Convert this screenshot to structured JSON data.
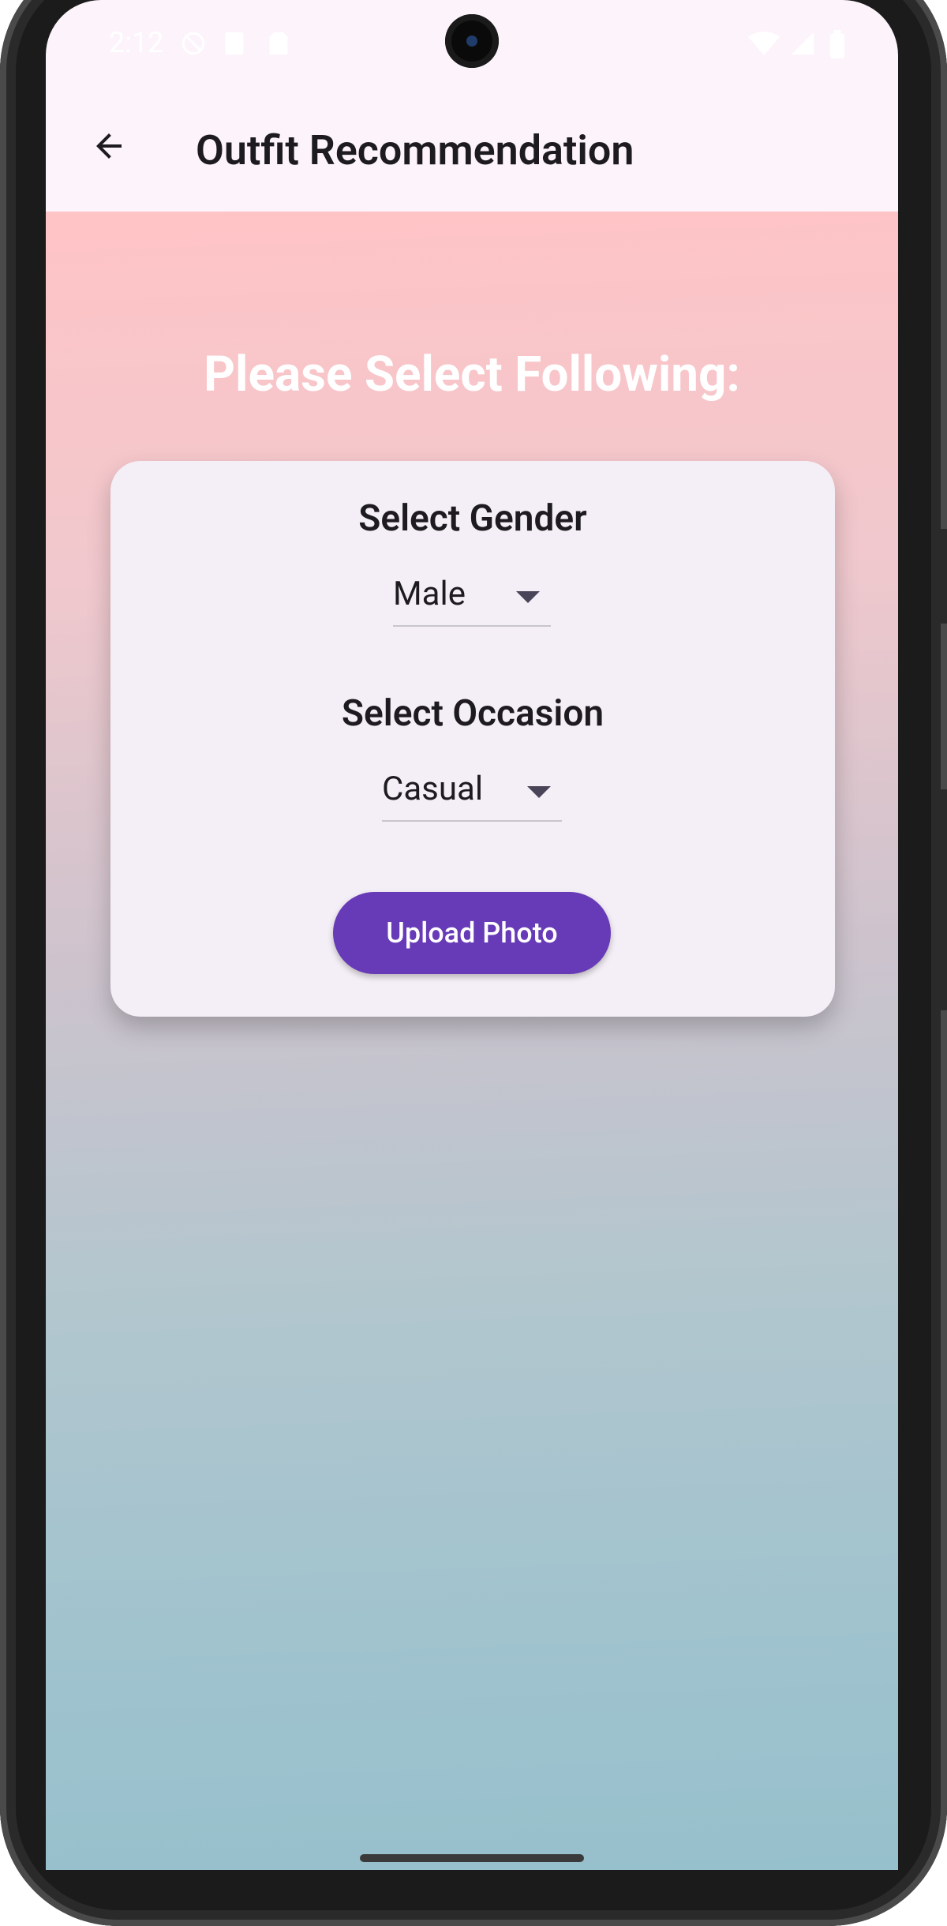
{
  "status_bar": {
    "time": "2:12"
  },
  "app_bar": {
    "title": "Outfit Recommendation"
  },
  "main": {
    "heading": "Please Select Following:",
    "gender_label": "Select Gender",
    "gender_value": "Male",
    "occasion_label": "Select Occasion",
    "occasion_value": "Casual",
    "upload_button": "Upload Photo"
  },
  "colors": {
    "accent": "#673ab7",
    "app_bar_bg": "#fdf4fb",
    "card_bg": "#f4eff6",
    "gradient_top": "#ffc4c6",
    "gradient_bottom": "#96c0cc"
  }
}
